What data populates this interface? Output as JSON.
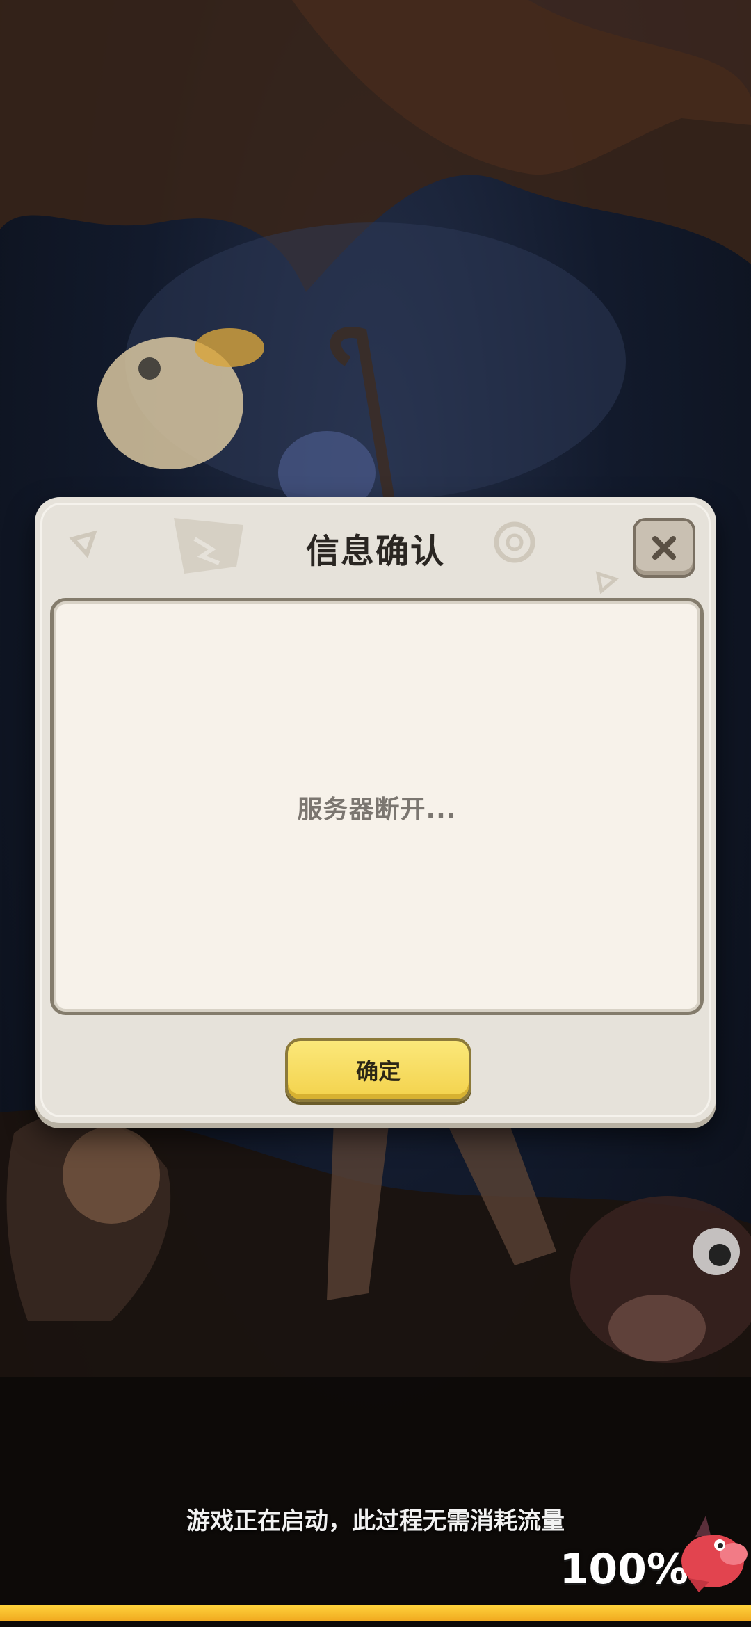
{
  "dialog": {
    "title": "信息确认",
    "message": "服务器断开...",
    "confirm_label": "确定",
    "close_icon": "close-icon"
  },
  "loading": {
    "status_text": "游戏正在启动，此过程无需消耗流量",
    "progress_text": "100%",
    "progress": 1.0
  },
  "colors": {
    "dialog_bg": "#e6e2da",
    "panel_bg": "#f7f2ea",
    "confirm_button": "#f3d24c",
    "progress_fill": "#ffd43d"
  }
}
